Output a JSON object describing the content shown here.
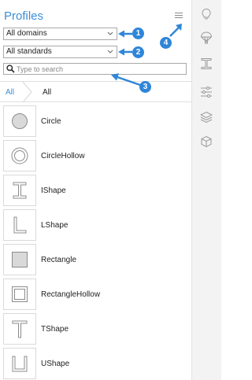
{
  "panel": {
    "title": "Profiles",
    "domain_select": "All domains",
    "standard_select": "All standards",
    "search_placeholder": "Type to search",
    "breadcrumb_root": "All",
    "breadcrumb_current": "All"
  },
  "profiles": [
    {
      "label": "Circle",
      "icon": "circle-icon"
    },
    {
      "label": "CircleHollow",
      "icon": "circle-hollow-icon"
    },
    {
      "label": "IShape",
      "icon": "i-shape-icon"
    },
    {
      "label": "LShape",
      "icon": "l-shape-icon"
    },
    {
      "label": "Rectangle",
      "icon": "rectangle-icon"
    },
    {
      "label": "RectangleHollow",
      "icon": "rectangle-hollow-icon"
    },
    {
      "label": "TShape",
      "icon": "t-shape-icon"
    },
    {
      "label": "UShape",
      "icon": "u-shape-icon"
    }
  ],
  "callouts": [
    "1",
    "2",
    "3",
    "4"
  ],
  "sidebar_icons": [
    "lightbulb-icon",
    "parachute-icon",
    "i-beam-icon",
    "sliders-icon",
    "layers-icon",
    "cube-icon"
  ],
  "colors": {
    "accent": "#3a8fd6",
    "callout": "#2f86d9"
  }
}
